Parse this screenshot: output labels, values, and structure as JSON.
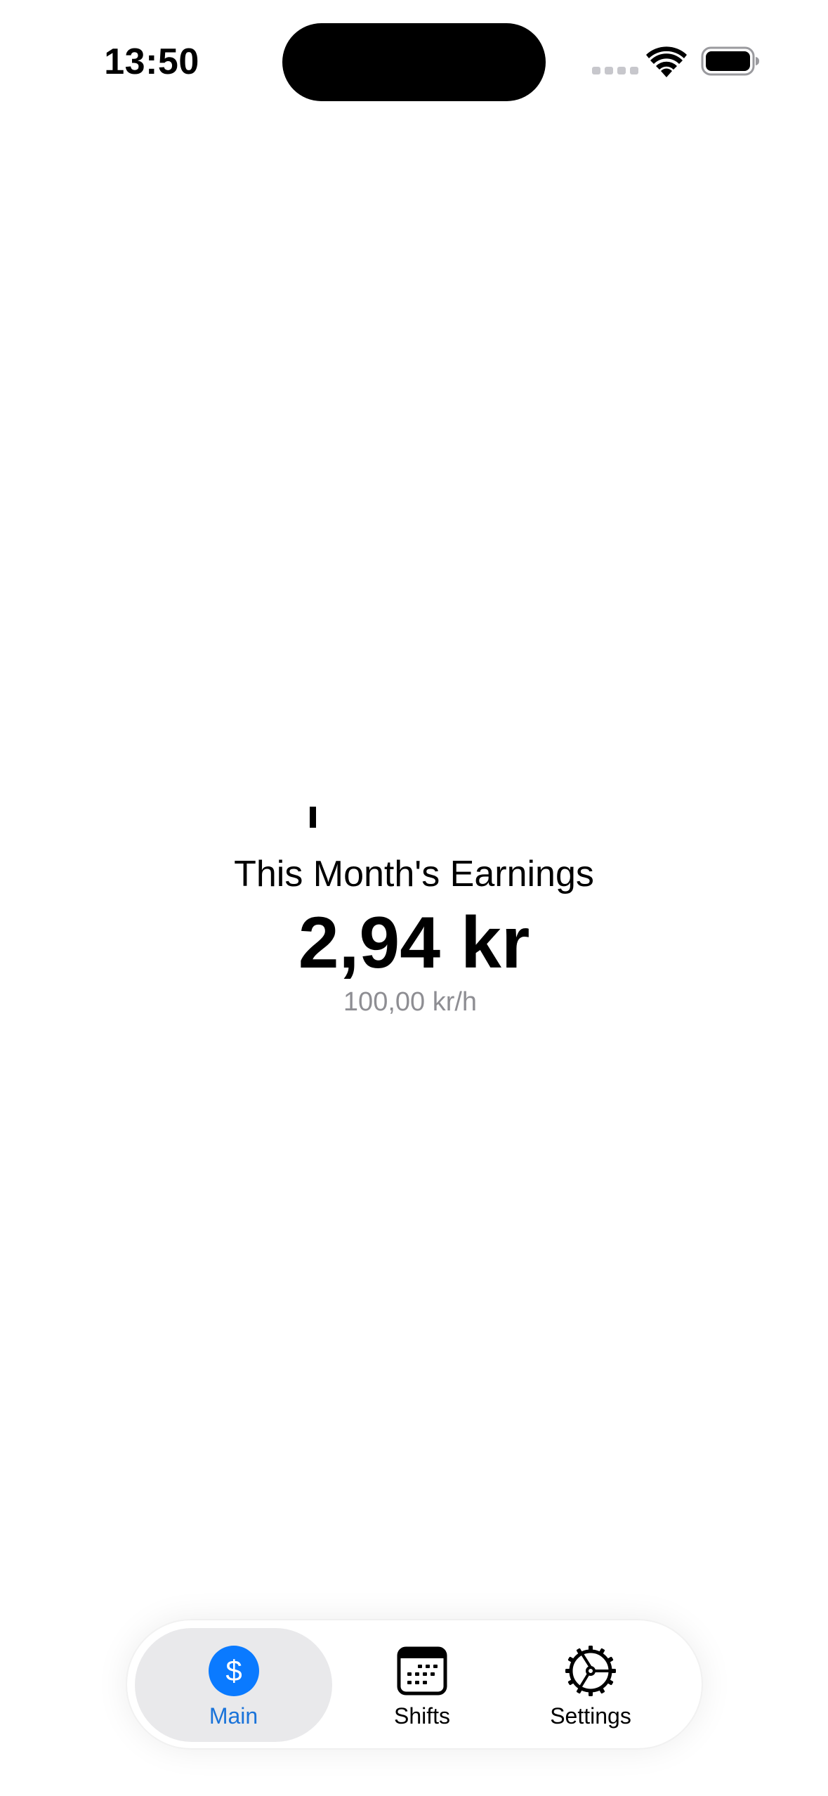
{
  "status_bar": {
    "time": "13:50"
  },
  "earnings": {
    "title": "This Month's Earnings",
    "amount": "2,94 kr",
    "rate": "100,00 kr/h"
  },
  "tab_bar": {
    "selected": "Main",
    "items": [
      {
        "label": "Main",
        "icon": "dollar-sign-icon"
      },
      {
        "label": "Shifts",
        "icon": "calendar-icon"
      },
      {
        "label": "Settings",
        "icon": "gear-icon"
      }
    ]
  },
  "colors": {
    "accent": "#1a73d9",
    "accent_circle": "#0a7aff",
    "secondary_text": "#8e8e93",
    "selected_tab_bg": "#e9e9eb"
  }
}
